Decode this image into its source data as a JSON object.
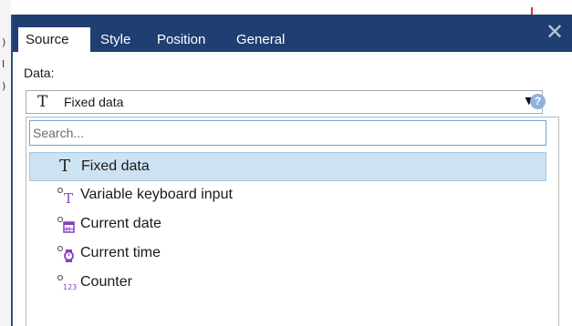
{
  "background": {
    "left_glyphs": [
      ")",
      "I",
      ")"
    ]
  },
  "dialog": {
    "tabs": [
      {
        "label": "Source",
        "active": true
      },
      {
        "label": "Style",
        "active": false
      },
      {
        "label": "Position",
        "active": false
      },
      {
        "label": "General",
        "active": false
      }
    ],
    "close_icon": "close-icon",
    "colors": {
      "titlebar": "#1f3e72",
      "selected_row": "#cde3f3",
      "accent_border": "#6aa4dc"
    }
  },
  "source": {
    "data_label": "Data:",
    "combo": {
      "icon": "text-T-icon",
      "value": "Fixed data"
    },
    "search": {
      "placeholder": "Search...",
      "value": ""
    },
    "options": [
      {
        "label": "Fixed data",
        "icon": "text-T-icon",
        "selected": true
      },
      {
        "label": "Variable keyboard input",
        "icon": "variable-keyboard-input-icon",
        "selected": false
      },
      {
        "label": "Current date",
        "icon": "current-date-icon",
        "selected": false
      },
      {
        "label": "Current time",
        "icon": "current-time-icon",
        "selected": false
      },
      {
        "label": "Counter",
        "icon": "counter-icon",
        "selected": false
      }
    ]
  }
}
